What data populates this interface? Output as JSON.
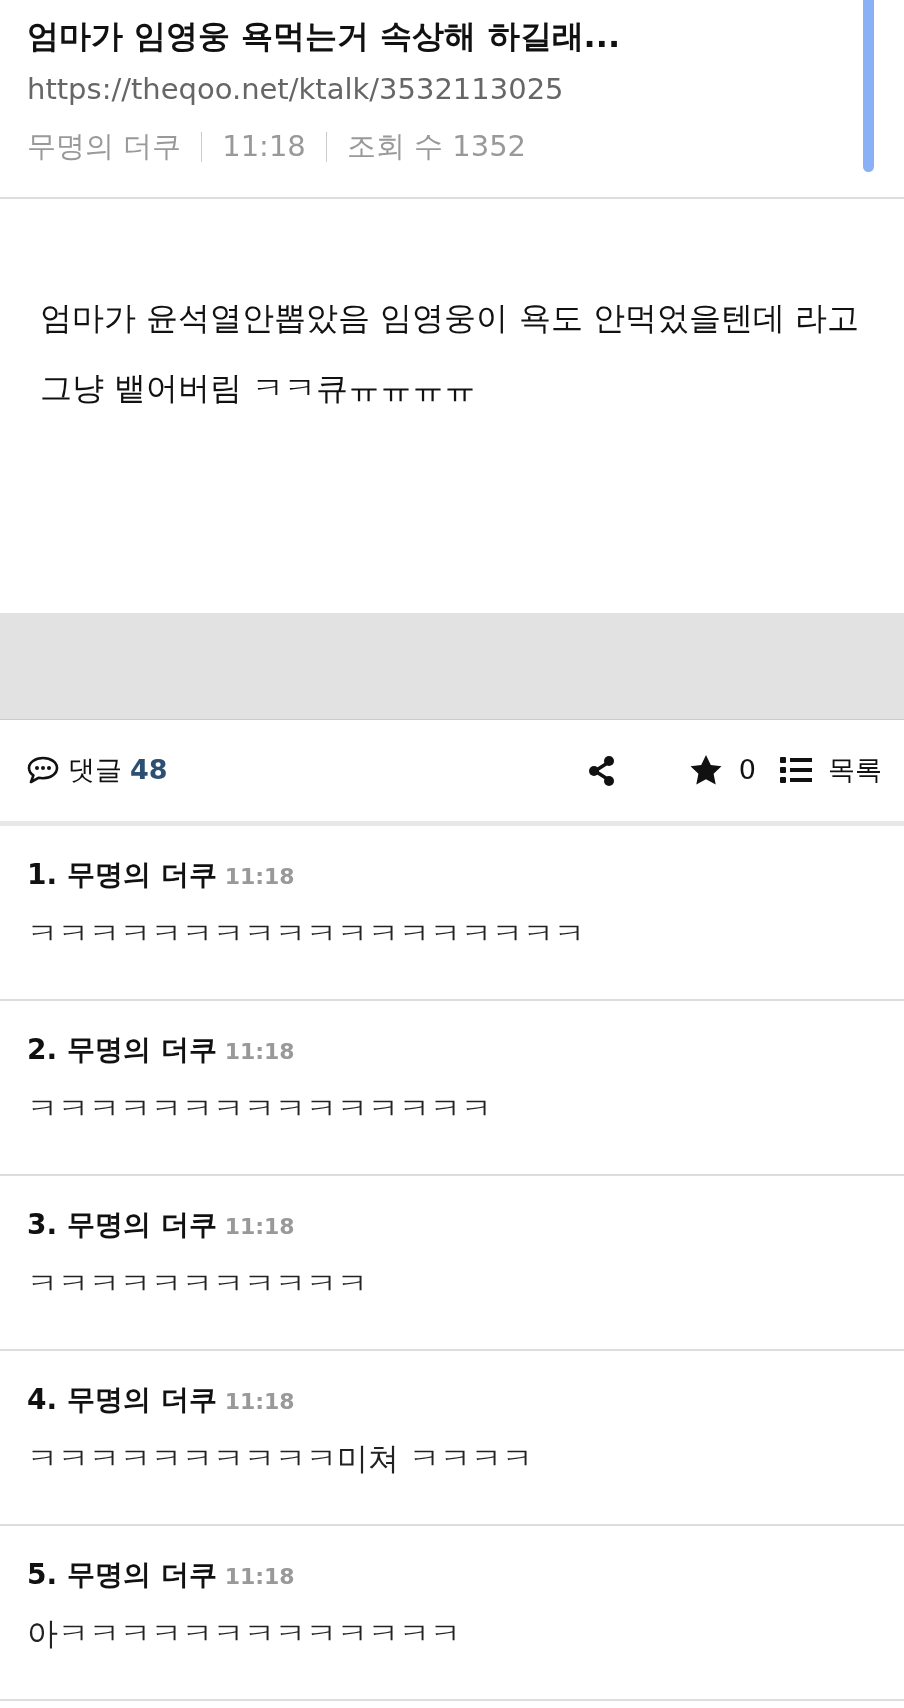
{
  "post": {
    "title": "엄마가 임영웅 욕먹는거 속상해 하길래...",
    "url": "https://theqoo.net/ktalk/3532113025",
    "meta": [
      "무명의 더쿠",
      "11:18",
      "조회 수 1352"
    ],
    "body": "엄마가 윤석열안뽑았음 임영웅이 욕도 안먹었을텐데 라고 그냥 뱉어버림 ㅋㅋ큐ㅠㅠㅠㅠ"
  },
  "toolbar": {
    "comments_label": "댓글",
    "comments_count": "48",
    "star_count": "0",
    "list_label": "목록"
  },
  "comments": [
    {
      "number": "1.",
      "author": "무명의 더쿠",
      "time": "11:18",
      "text": "ㅋㅋㅋㅋㅋㅋㅋㅋㅋㅋㅋㅋㅋㅋㅋㅋㅋㅋ"
    },
    {
      "number": "2.",
      "author": "무명의 더쿠",
      "time": "11:18",
      "text": "ㅋㅋㅋㅋㅋㅋㅋㅋㅋㅋㅋㅋㅋㅋㅋ"
    },
    {
      "number": "3.",
      "author": "무명의 더쿠",
      "time": "11:18",
      "text": "ㅋㅋㅋㅋㅋㅋㅋㅋㅋㅋㅋ"
    },
    {
      "number": "4.",
      "author": "무명의 더쿠",
      "time": "11:18",
      "text": "ㅋㅋㅋㅋㅋㅋㅋㅋㅋㅋ미쳐 ㅋㅋㅋㅋ"
    },
    {
      "number": "5.",
      "author": "무명의 더쿠",
      "time": "11:18",
      "text": "아ㅋㅋㅋㅋㅋㅋㅋㅋㅋㅋㅋㅋㅋ"
    }
  ]
}
